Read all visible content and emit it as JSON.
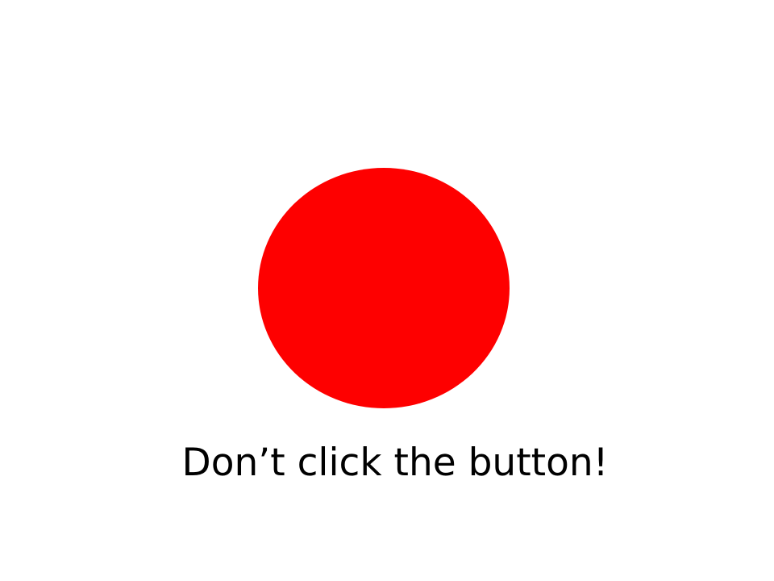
{
  "slide": {
    "caption": "Don’t click the button!"
  },
  "button": {
    "color": "#fe0000"
  }
}
